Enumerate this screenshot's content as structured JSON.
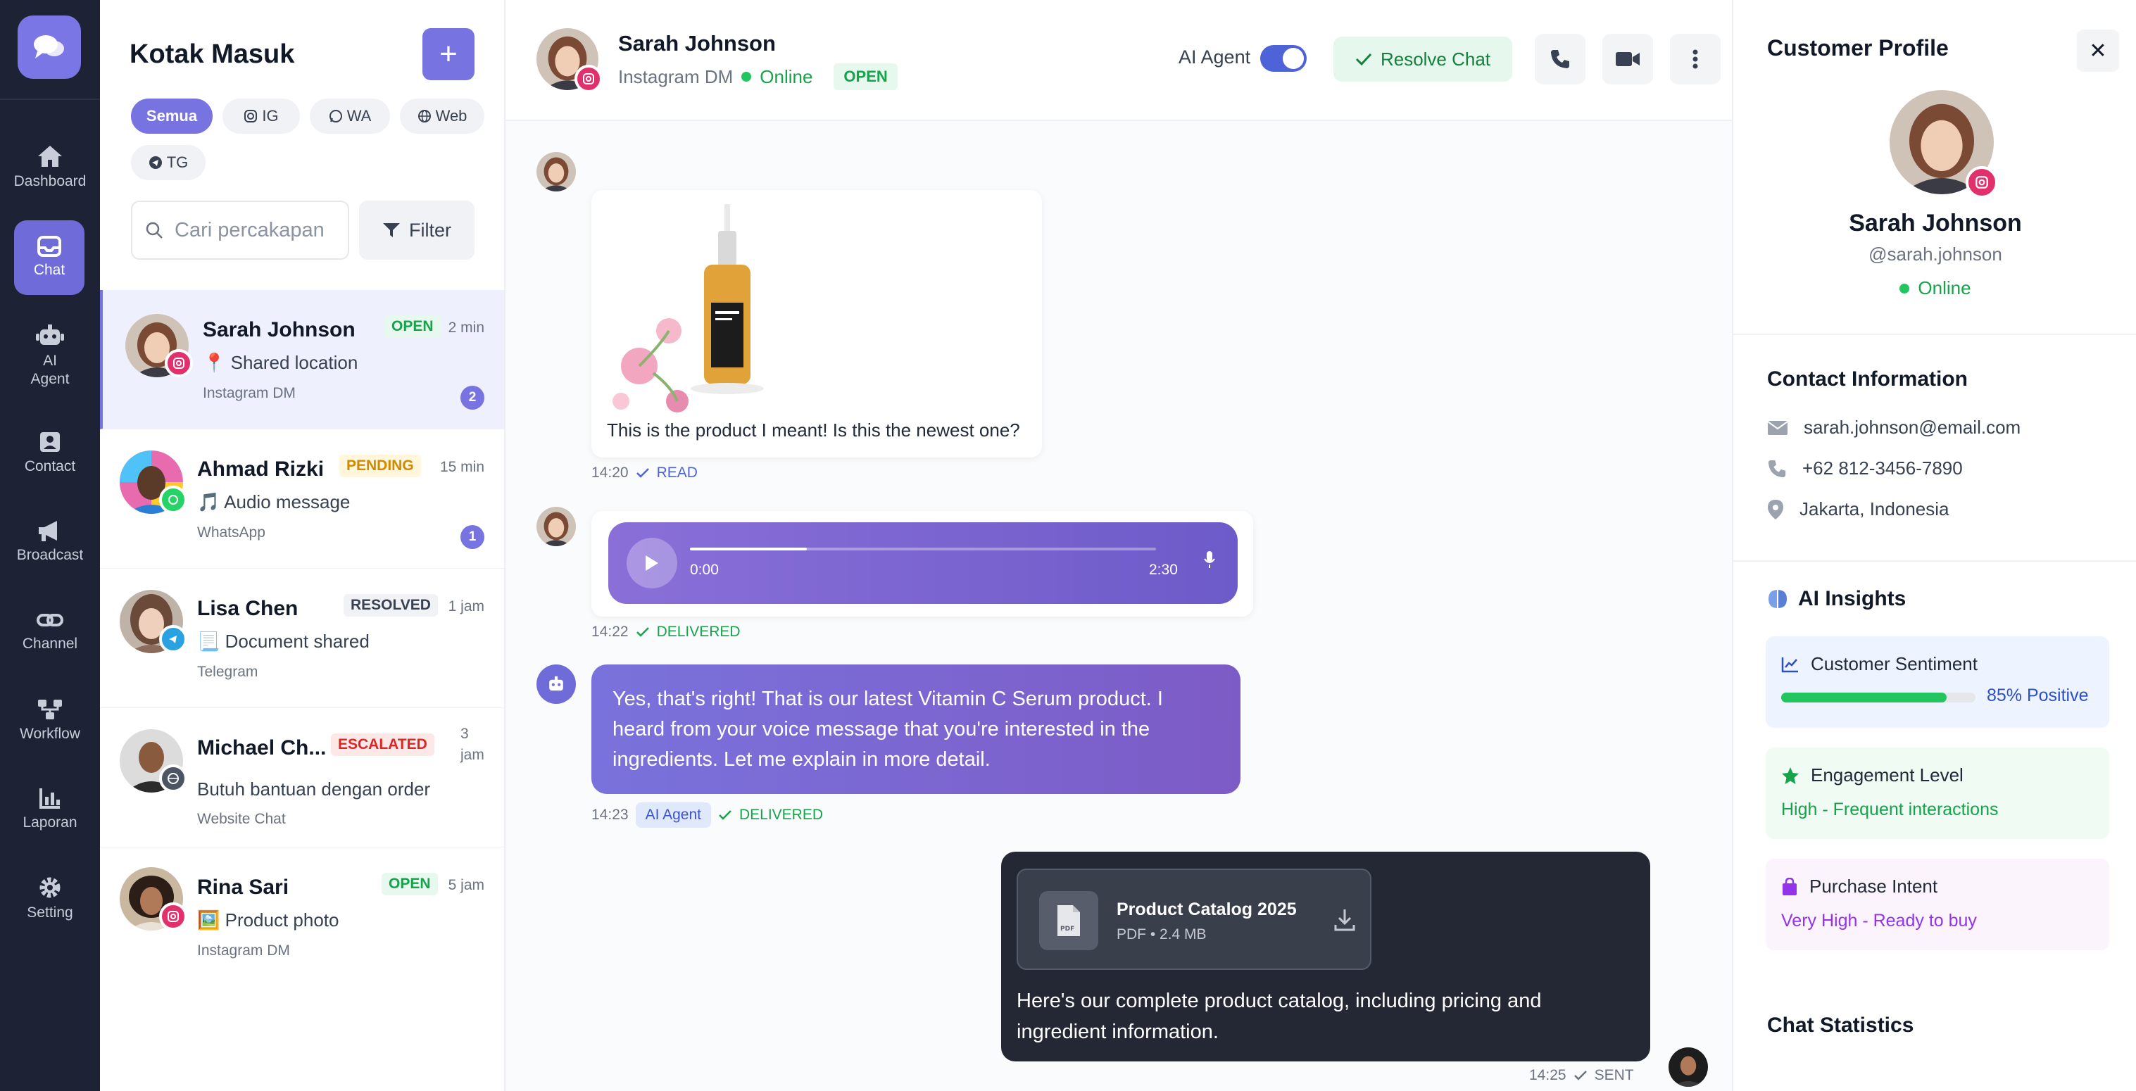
{
  "colors": {
    "accent": "#7773e0",
    "nav_bg": "#1e2235",
    "success": "#16a34a",
    "danger": "#dc2626",
    "warning": "#d18a00",
    "instagram": "#e1306c",
    "whatsapp": "#25d366",
    "telegram": "#2aa1e0"
  },
  "nav": {
    "logo_icon": "chat-bubbles-icon",
    "items": [
      {
        "label": "Dashboard",
        "icon": "home-icon"
      },
      {
        "label": "Chat",
        "icon": "inbox-icon",
        "active": true
      },
      {
        "label": "AI Agent",
        "icon": "robot-icon"
      },
      {
        "label": "Contact",
        "icon": "contact-card-icon"
      },
      {
        "label": "Broadcast",
        "icon": "megaphone-icon"
      },
      {
        "label": "Channel",
        "icon": "link-icon"
      },
      {
        "label": "Workflow",
        "icon": "workflow-icon"
      },
      {
        "label": "Laporan",
        "icon": "chart-icon"
      },
      {
        "label": "Setting",
        "icon": "gear-icon"
      }
    ]
  },
  "inbox": {
    "title": "Kotak Masuk",
    "add_icon": "+",
    "filters": [
      {
        "label": "Semua",
        "active": true
      },
      {
        "label": "IG",
        "icon": "instagram-icon"
      },
      {
        "label": "WA",
        "icon": "whatsapp-icon"
      },
      {
        "label": "Web",
        "icon": "globe-icon"
      },
      {
        "label": "TG",
        "icon": "telegram-icon"
      }
    ],
    "search_placeholder": "Cari percakapan",
    "filter_label": "Filter",
    "conversations": [
      {
        "name": "Sarah Johnson",
        "status": "OPEN",
        "time": "2 min",
        "preview": "📍 Shared location",
        "source": "Instagram DM",
        "unread": "2",
        "channel": "instagram"
      },
      {
        "name": "Ahmad Rizki",
        "status": "PENDING",
        "time": "15 min",
        "preview": "🎵 Audio message",
        "source": "WhatsApp",
        "unread": "1",
        "channel": "whatsapp"
      },
      {
        "name": "Lisa Chen",
        "status": "RESOLVED",
        "time": "1 jam",
        "preview": "📃 Document shared",
        "source": "Telegram",
        "channel": "telegram"
      },
      {
        "name": "Michael Ch...",
        "status": "ESCALATED",
        "time": "3 jam",
        "preview": "Butuh bantuan dengan order",
        "source": "Website Chat",
        "channel": "web"
      },
      {
        "name": "Rina Sari",
        "status": "OPEN",
        "time": "5 jam",
        "preview": "🖼️ Product photo",
        "source": "Instagram DM",
        "channel": "instagram"
      }
    ]
  },
  "chat": {
    "contact_name": "Sarah Johnson",
    "source": "Instagram DM",
    "presence": "Online",
    "status": "OPEN",
    "ai_agent_label": "AI Agent",
    "ai_agent_on": true,
    "resolve_label": "Resolve Chat",
    "messages": [
      {
        "type": "image",
        "text": "This is the product I meant! Is this the newest one?",
        "time": "14:20",
        "receipt": "READ"
      },
      {
        "type": "voice",
        "start": "0:00",
        "duration": "2:30",
        "progress": 0.25,
        "time": "14:22",
        "receipt": "DELIVERED"
      },
      {
        "type": "ai",
        "text": "Yes, that's right! That is our latest Vitamin C Serum product. I heard from your voice message that you're interested in the ingredients. Let me explain in more detail.",
        "time": "14:23",
        "tag": "AI Agent",
        "receipt": "DELIVERED"
      },
      {
        "type": "file",
        "file_name": "Product Catalog 2025",
        "file_meta": "PDF • 2.4 MB",
        "file_badge": "PDF",
        "text": "Here's our complete product catalog, including pricing and ingredient information.",
        "time": "14:25",
        "receipt": "SENT"
      }
    ]
  },
  "profile": {
    "title": "Customer Profile",
    "close_icon": "✕",
    "name": "Sarah Johnson",
    "handle": "@sarah.johnson",
    "presence": "Online",
    "contact_title": "Contact Information",
    "email": "sarah.johnson@email.com",
    "phone": "+62 812-3456-7890",
    "location": "Jakarta, Indonesia",
    "insights_title": "AI Insights",
    "sentiment_title": "Customer Sentiment",
    "sentiment_value": "85% Positive",
    "sentiment_progress": 0.85,
    "engagement_title": "Engagement Level",
    "engagement_value": "High - Frequent interactions",
    "intent_title": "Purchase Intent",
    "intent_value": "Very High - Ready to buy",
    "stats_title": "Chat Statistics"
  }
}
